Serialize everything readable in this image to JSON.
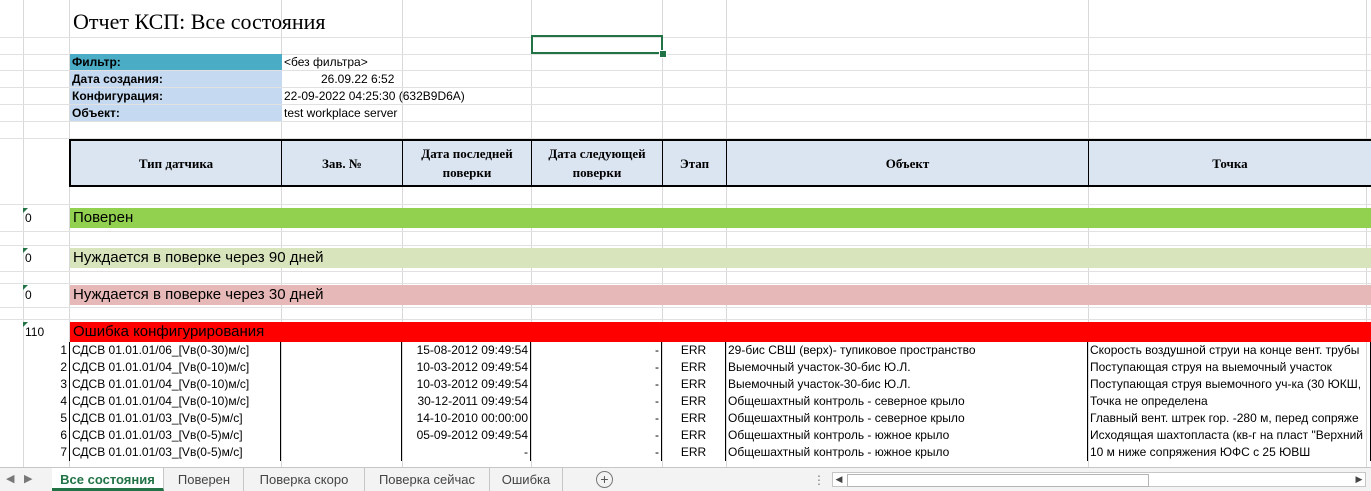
{
  "report": {
    "title": "Отчет КСП: Все состояния",
    "info": [
      {
        "label": "Фильтр:",
        "value": "<без фильтра>"
      },
      {
        "label": "Дата создания:",
        "value": "26.09.22 6:52"
      },
      {
        "label": "Конфигурация:",
        "value": "22-09-2022 04:25:30 (632B9D6A)"
      },
      {
        "label": "Объект:",
        "value": "test workplace server"
      }
    ],
    "label_colors": {
      "filter": "#4bacc6",
      "other": "#c5d9f1"
    }
  },
  "table": {
    "headers": [
      {
        "line1": "Тип датчика",
        "line2": ""
      },
      {
        "line1": "Зав. №",
        "line2": ""
      },
      {
        "line1": "Дата последней",
        "line2": "поверки"
      },
      {
        "line1": "Дата следующей",
        "line2": "поверки"
      },
      {
        "line1": "Этап",
        "line2": ""
      },
      {
        "line1": "Объект",
        "line2": ""
      },
      {
        "line1": "Точка",
        "line2": ""
      }
    ],
    "header_bg": "#dbe5f1"
  },
  "groups": [
    {
      "count": "0",
      "label": "Поверен",
      "color": "#92d050"
    },
    {
      "count": "0",
      "label": "Нуждается в поверке через 90 дней",
      "color": "#d8e4bc"
    },
    {
      "count": "0",
      "label": "Нуждается в поверке через 30 дней",
      "color": "#e6b8b7"
    },
    {
      "count": "110",
      "label": "Ошибка конфигурирования",
      "color": "#ff0000"
    }
  ],
  "rows": [
    {
      "n": "1",
      "type": "СДСВ 01.01.01/06_[Vв(0-30)м/с]",
      "serial": "",
      "last": "15-08-2012 09:49:54",
      "next": "-",
      "stage": "ERR",
      "object": "29-бис СВШ (верх)- тупиковое пространство",
      "point": "Скорость воздушной струи на конце вент. трубы"
    },
    {
      "n": "2",
      "type": "СДСВ 01.01.01/04_[Vв(0-10)м/с]",
      "serial": "",
      "last": "10-03-2012 09:49:54",
      "next": "-",
      "stage": "ERR",
      "object": "Выемочный участок-30-бис Ю.Л.",
      "point": "Поступающая струя на выемочный  участок"
    },
    {
      "n": "3",
      "type": "СДСВ 01.01.01/04_[Vв(0-10)м/с]",
      "serial": "",
      "last": "10-03-2012 09:49:54",
      "next": "-",
      "stage": "ERR",
      "object": "Выемочный участок-30-бис Ю.Л.",
      "point": "Поступающая струя выемочного уч-ка (30 ЮКШ,"
    },
    {
      "n": "4",
      "type": "СДСВ 01.01.01/04_[Vв(0-10)м/с]",
      "serial": "",
      "last": "30-12-2011 09:49:54",
      "next": "-",
      "stage": "ERR",
      "object": "Общешахтный контроль - северное крыло",
      "point": "Точка не определена"
    },
    {
      "n": "5",
      "type": "СДСВ 01.01.01/03_[Vв(0-5)м/с]",
      "serial": "",
      "last": "14-10-2010 00:00:00",
      "next": "-",
      "stage": "ERR",
      "object": "Общешахтный контроль - северное крыло",
      "point": "Главный вент. штрек гор. -280 м, перед сопряже"
    },
    {
      "n": "6",
      "type": "СДСВ 01.01.01/03_[Vв(0-5)м/с]",
      "serial": "",
      "last": "05-09-2012 09:49:54",
      "next": "-",
      "stage": "ERR",
      "object": "Общешахтный контроль - южное крыло",
      "point": "Исходящая шахтопласта (кв-г на пласт \"Верхний"
    },
    {
      "n": "7",
      "type": "СДСВ 01.01.01/03_[Vв(0-5)м/с]",
      "serial": "",
      "last": "-",
      "next": "-",
      "stage": "ERR",
      "object": "Общешахтный контроль - южное крыло",
      "point": "10 м ниже сопряжения ЮФС с 25 ЮВШ"
    }
  ],
  "tabs": [
    {
      "label": "Все состояния",
      "active": true
    },
    {
      "label": "Поверен",
      "active": false
    },
    {
      "label": "Поверка скоро",
      "active": false
    },
    {
      "label": "Поверка сейчас",
      "active": false
    },
    {
      "label": "Ошибка",
      "active": false
    }
  ]
}
